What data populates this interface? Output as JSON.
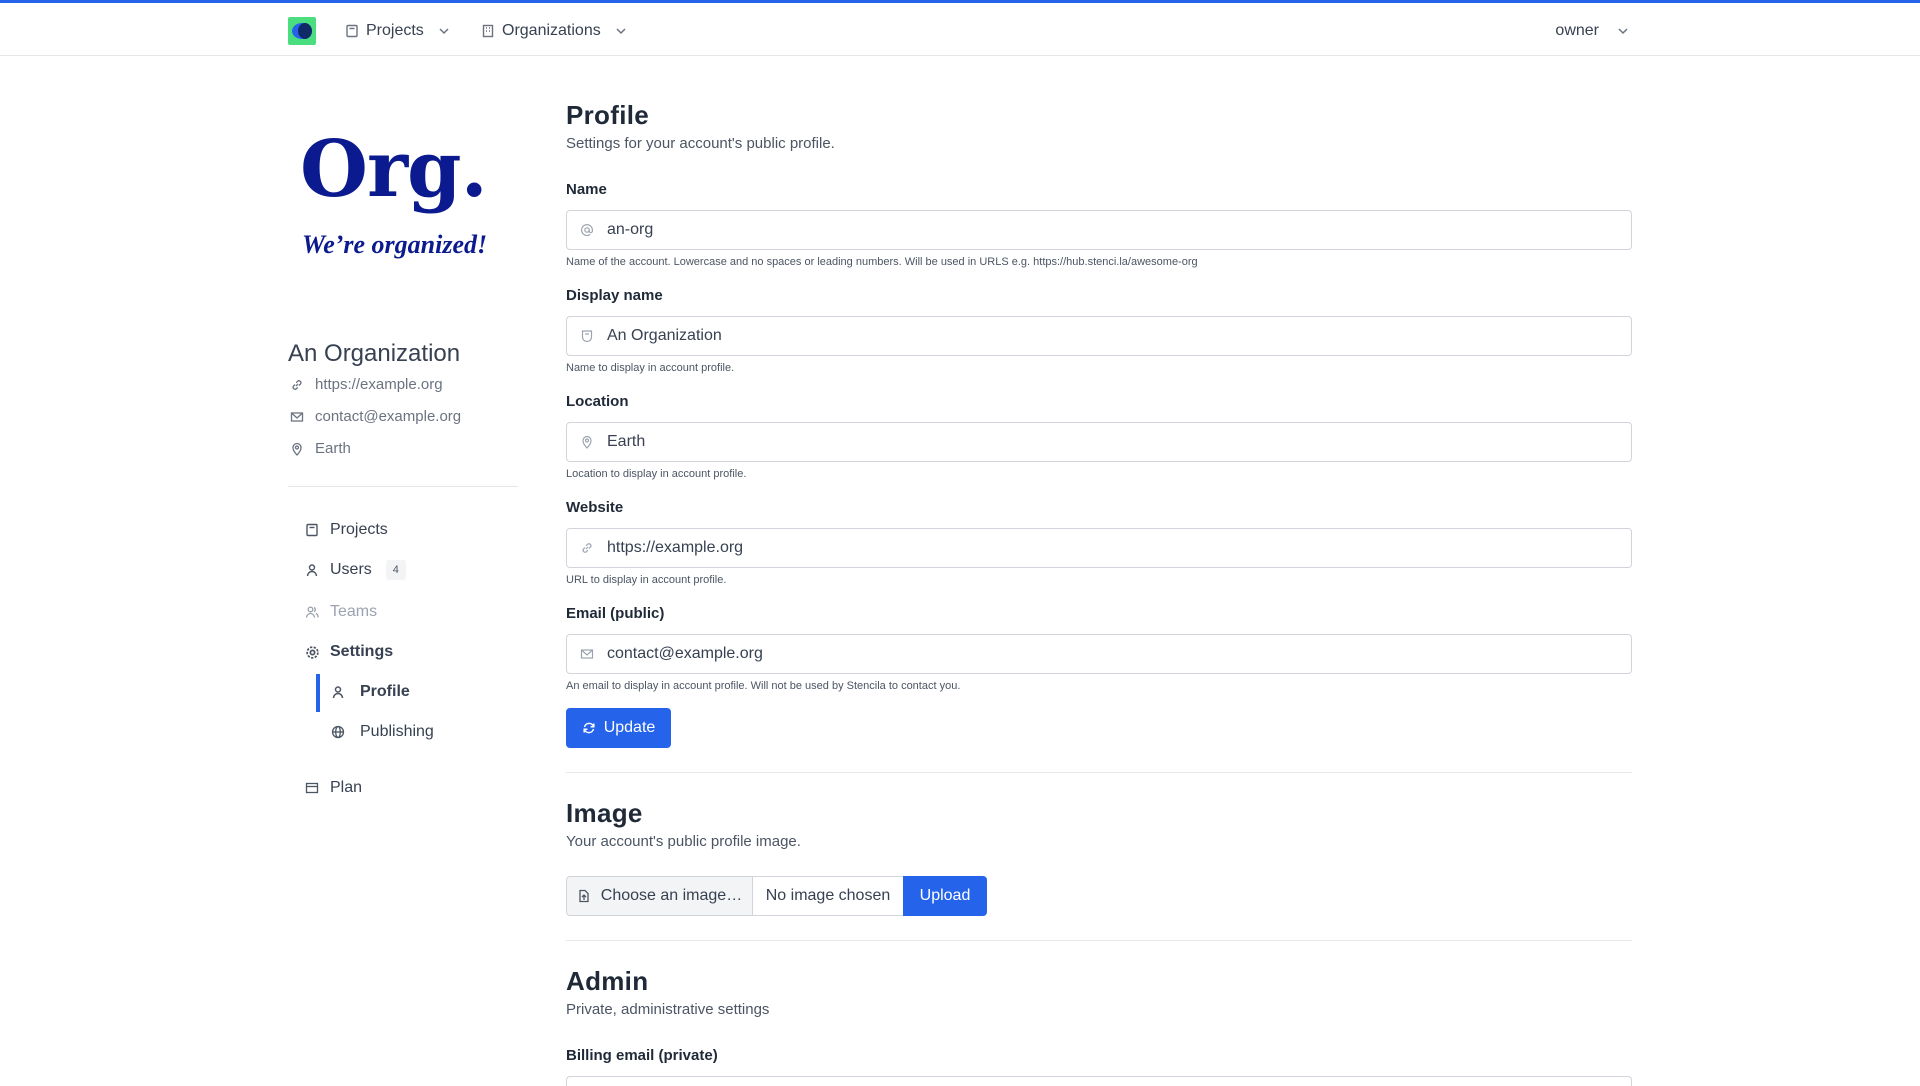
{
  "topbar": {
    "projects_label": "Projects",
    "organizations_label": "Organizations",
    "user_label": "owner"
  },
  "sidebar": {
    "logo_text": "Org.",
    "logo_tagline": "We’re organized!",
    "org_name": "An Organization",
    "website": "https://example.org",
    "email": "contact@example.org",
    "location": "Earth",
    "nav": {
      "projects": "Projects",
      "users": "Users",
      "users_count": "4",
      "teams": "Teams",
      "settings": "Settings",
      "profile": "Profile",
      "publishing": "Publishing",
      "plan": "Plan"
    }
  },
  "profile": {
    "title": "Profile",
    "description": "Settings for your account's public profile.",
    "name": {
      "label": "Name",
      "value": "an-org",
      "help": "Name of the account. Lowercase and no spaces or leading numbers. Will be used in URLS e.g. https://hub.stenci.la/awesome-org"
    },
    "display_name": {
      "label": "Display name",
      "value": "An Organization",
      "help": "Name to display in account profile."
    },
    "location": {
      "label": "Location",
      "value": "Earth",
      "help": "Location to display in account profile."
    },
    "website": {
      "label": "Website",
      "value": "https://example.org",
      "help": "URL to display in account profile."
    },
    "email": {
      "label": "Email (public)",
      "value": "contact@example.org",
      "help": "An email to display in account profile. Will not be used by Stencila to contact you."
    },
    "update_label": "Update"
  },
  "image": {
    "title": "Image",
    "description": "Your account's public profile image.",
    "choose_label": "Choose an image…",
    "file_status": "No image chosen",
    "upload_label": "Upload"
  },
  "admin": {
    "title": "Admin",
    "description": "Private, administrative settings",
    "billing_email_label": "Billing email (private)"
  },
  "colors": {
    "accent": "#2563eb",
    "logo_green": "#4ade80",
    "org_logo_navy": "#0b1b8f"
  }
}
